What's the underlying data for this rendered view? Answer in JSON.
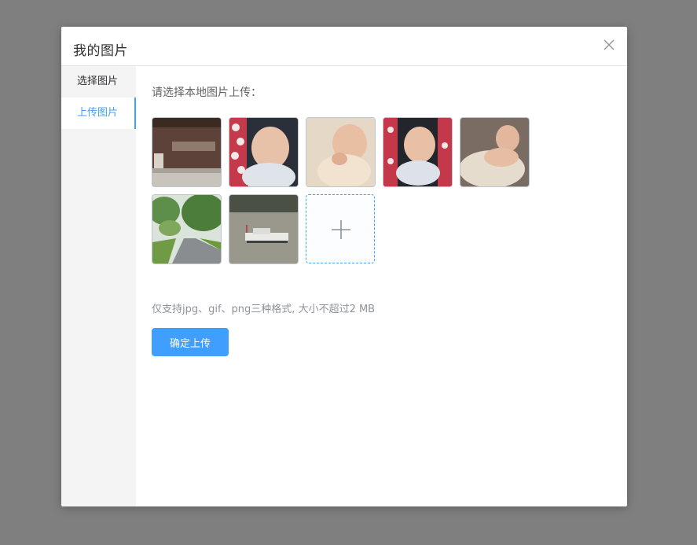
{
  "dialog": {
    "title": "我的图片",
    "close_icon": "close-icon"
  },
  "sidebar": {
    "items": [
      {
        "label": "选择图片",
        "active": false
      },
      {
        "label": "上传图片",
        "active": true
      }
    ]
  },
  "upload": {
    "prompt": "请选择本地图片上传：",
    "thumbnails": [
      {
        "subject": "lobby-wall-sign"
      },
      {
        "subject": "baby-in-stroller"
      },
      {
        "subject": "baby-lying-down"
      },
      {
        "subject": "baby-in-stroller"
      },
      {
        "subject": "baby-on-blanket"
      },
      {
        "subject": "park-path-trees"
      },
      {
        "subject": "boat-on-river"
      }
    ],
    "add_icon": "plus-icon",
    "hint": "仅支持jpg、gif、png三种格式, 大小不超过2 MB",
    "confirm_label": "确定上传"
  },
  "colors": {
    "accent": "#409eff",
    "overlay": "#7f7f7f"
  }
}
